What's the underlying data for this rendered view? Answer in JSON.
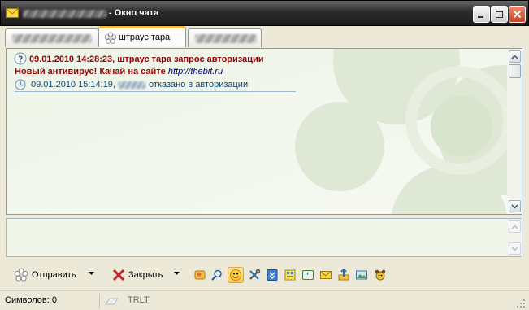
{
  "window": {
    "title": "- Окно чата",
    "controls": [
      "minimize",
      "maximize",
      "close"
    ]
  },
  "tabs": [
    {
      "label": "",
      "active": false
    },
    {
      "label": "штраус  тара",
      "active": true,
      "icon": "flower-icon"
    },
    {
      "label": "",
      "active": false
    }
  ],
  "messages": [
    {
      "icon": "question-icon",
      "text": "09.01.2010 14:28:23, штраус  тара запрос авторизации"
    },
    {
      "text": "Новый антивирус! Качай на сайте ",
      "link": "http://thebit.ru"
    },
    {
      "icon": "clock-icon",
      "time": "09.01.2010 15:14:19,",
      "text": "отказано в авторизации"
    }
  ],
  "input": {
    "value": ""
  },
  "toolbar": {
    "send_label": "Отправить",
    "close_label": "Закрыть",
    "icons": [
      "contacts-icon",
      "search-icon",
      "smiley-icon",
      "tools-icon",
      "history-icon",
      "notes-icon",
      "quote-icon",
      "envelope-icon",
      "upload-icon",
      "image-icon",
      "squirrel-icon"
    ]
  },
  "status": {
    "chars": "Символов: 0",
    "keyboard": "TRLT"
  },
  "colors": {
    "system_message": "#990000",
    "link": "#000080",
    "event_message": "#0b4577",
    "pane_background": "#f0f5ea"
  }
}
